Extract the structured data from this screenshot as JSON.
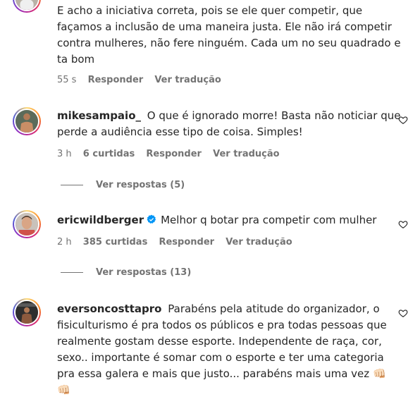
{
  "comments": [
    {
      "text": "E acho a iniciativa correta, pois se ele quer competir, que façamos a inclusão de uma maneira justa. Ele não irá competir contra mulheres, não fere ninguém. Cada um no seu quadrado e ta bom",
      "time": "55 s",
      "reply_label": "Responder",
      "translate_label": "Ver tradução"
    },
    {
      "username": "mikesampaio_",
      "text": "O que é ignorado morre! Basta não noticiar que perde a audiência esse tipo de coisa. Simples!",
      "time": "3 h",
      "likes": "6 curtidas",
      "reply_label": "Responder",
      "translate_label": "Ver tradução",
      "view_replies": "Ver respostas (5)"
    },
    {
      "username": "ericwildberger",
      "verified": true,
      "text": "Melhor q botar pra competir com mulher",
      "time": "2 h",
      "likes": "385 curtidas",
      "reply_label": "Responder",
      "translate_label": "Ver tradução",
      "view_replies": "Ver respostas (13)"
    },
    {
      "username": "eversoncosttapro",
      "text": "Parabéns pela atitude do organizador, o fisiculturismo é pra todos os públicos e pra todas pessoas que realmente gostam desse esporte. Independente de raça, cor, sexo.. importante é somar com o esporte e ter uma categoria pra essa galera e mais que justo... parabéns mais uma vez",
      "emojis": "👊🏻 👊🏻"
    }
  ],
  "colors": {
    "text": "#262626",
    "secondary": "#737373",
    "verified": "#0095f6"
  }
}
